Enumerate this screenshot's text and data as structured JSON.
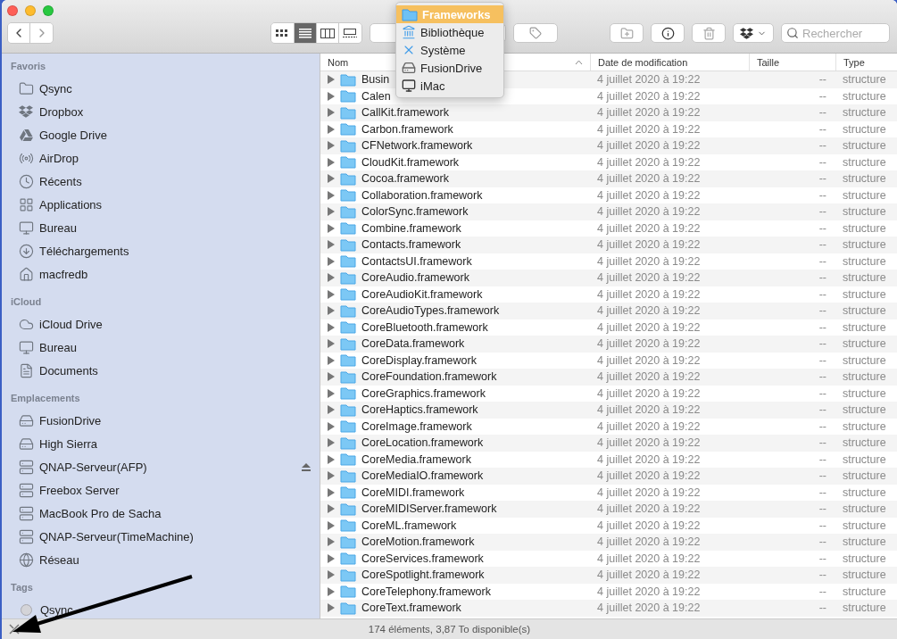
{
  "toolbar": {
    "view_buttons": [
      {
        "kind": "icons",
        "selected": false
      },
      {
        "kind": "list",
        "selected": true
      },
      {
        "kind": "columns",
        "selected": false
      },
      {
        "kind": "gallery",
        "selected": false
      }
    ],
    "search": {
      "placeholder": "Rechercher"
    }
  },
  "path_menu": [
    {
      "label": "Frameworks",
      "kind": "folder",
      "selected": true
    },
    {
      "label": "Bibliothèque",
      "kind": "library",
      "selected": false
    },
    {
      "label": "Système",
      "kind": "system",
      "selected": false
    },
    {
      "label": "FusionDrive",
      "kind": "drive",
      "selected": false
    },
    {
      "label": "iMac",
      "kind": "computer",
      "selected": false
    }
  ],
  "sidebar": [
    {
      "title": "Favoris",
      "items": [
        {
          "label": "Qsync",
          "kind": "folder"
        },
        {
          "label": "Dropbox",
          "kind": "dropbox"
        },
        {
          "label": "Google Drive",
          "kind": "gdrive"
        },
        {
          "label": "AirDrop",
          "kind": "airdrop"
        },
        {
          "label": "Récents",
          "kind": "clock"
        },
        {
          "label": "Applications",
          "kind": "apps"
        },
        {
          "label": "Bureau",
          "kind": "desktop"
        },
        {
          "label": "Téléchargements",
          "kind": "download"
        },
        {
          "label": "macfredb",
          "kind": "home"
        }
      ]
    },
    {
      "title": "iCloud",
      "items": [
        {
          "label": "iCloud Drive",
          "kind": "cloud"
        },
        {
          "label": "Bureau",
          "kind": "desktop"
        },
        {
          "label": "Documents",
          "kind": "document"
        }
      ]
    },
    {
      "title": "Emplacements",
      "items": [
        {
          "label": "FusionDrive",
          "kind": "disk"
        },
        {
          "label": "High Sierra",
          "kind": "disk"
        },
        {
          "label": "QNAP-Serveur(AFP)",
          "kind": "server",
          "ejectable": true
        },
        {
          "label": "Freebox Server",
          "kind": "server"
        },
        {
          "label": "MacBook Pro de Sacha",
          "kind": "server"
        },
        {
          "label": "QNAP-Serveur(TimeMachine)",
          "kind": "server"
        },
        {
          "label": "Réseau",
          "kind": "network"
        }
      ]
    },
    {
      "title": "Tags",
      "items": [
        {
          "label": "Qsync",
          "kind": "tag",
          "color": "#d4d4d8"
        }
      ]
    }
  ],
  "table": {
    "columns": [
      "Nom",
      "Date de modification",
      "Taille",
      "Type"
    ],
    "rows": [
      {
        "name": "Busin",
        "date": "4 juillet 2020 à 19:22",
        "size": "--",
        "type": "structure"
      },
      {
        "name": "Calen",
        "date": "4 juillet 2020 à 19:22",
        "size": "--",
        "type": "structure"
      },
      {
        "name": "CallKit.framework",
        "date": "4 juillet 2020 à 19:22",
        "size": "--",
        "type": "structure"
      },
      {
        "name": "Carbon.framework",
        "date": "4 juillet 2020 à 19:22",
        "size": "--",
        "type": "structure"
      },
      {
        "name": "CFNetwork.framework",
        "date": "4 juillet 2020 à 19:22",
        "size": "--",
        "type": "structure"
      },
      {
        "name": "CloudKit.framework",
        "date": "4 juillet 2020 à 19:22",
        "size": "--",
        "type": "structure"
      },
      {
        "name": "Cocoa.framework",
        "date": "4 juillet 2020 à 19:22",
        "size": "--",
        "type": "structure"
      },
      {
        "name": "Collaboration.framework",
        "date": "4 juillet 2020 à 19:22",
        "size": "--",
        "type": "structure"
      },
      {
        "name": "ColorSync.framework",
        "date": "4 juillet 2020 à 19:22",
        "size": "--",
        "type": "structure"
      },
      {
        "name": "Combine.framework",
        "date": "4 juillet 2020 à 19:22",
        "size": "--",
        "type": "structure"
      },
      {
        "name": "Contacts.framework",
        "date": "4 juillet 2020 à 19:22",
        "size": "--",
        "type": "structure"
      },
      {
        "name": "ContactsUI.framework",
        "date": "4 juillet 2020 à 19:22",
        "size": "--",
        "type": "structure"
      },
      {
        "name": "CoreAudio.framework",
        "date": "4 juillet 2020 à 19:22",
        "size": "--",
        "type": "structure"
      },
      {
        "name": "CoreAudioKit.framework",
        "date": "4 juillet 2020 à 19:22",
        "size": "--",
        "type": "structure"
      },
      {
        "name": "CoreAudioTypes.framework",
        "date": "4 juillet 2020 à 19:22",
        "size": "--",
        "type": "structure"
      },
      {
        "name": "CoreBluetooth.framework",
        "date": "4 juillet 2020 à 19:22",
        "size": "--",
        "type": "structure"
      },
      {
        "name": "CoreData.framework",
        "date": "4 juillet 2020 à 19:22",
        "size": "--",
        "type": "structure"
      },
      {
        "name": "CoreDisplay.framework",
        "date": "4 juillet 2020 à 19:22",
        "size": "--",
        "type": "structure"
      },
      {
        "name": "CoreFoundation.framework",
        "date": "4 juillet 2020 à 19:22",
        "size": "--",
        "type": "structure"
      },
      {
        "name": "CoreGraphics.framework",
        "date": "4 juillet 2020 à 19:22",
        "size": "--",
        "type": "structure"
      },
      {
        "name": "CoreHaptics.framework",
        "date": "4 juillet 2020 à 19:22",
        "size": "--",
        "type": "structure"
      },
      {
        "name": "CoreImage.framework",
        "date": "4 juillet 2020 à 19:22",
        "size": "--",
        "type": "structure"
      },
      {
        "name": "CoreLocation.framework",
        "date": "4 juillet 2020 à 19:22",
        "size": "--",
        "type": "structure"
      },
      {
        "name": "CoreMedia.framework",
        "date": "4 juillet 2020 à 19:22",
        "size": "--",
        "type": "structure"
      },
      {
        "name": "CoreMediaIO.framework",
        "date": "4 juillet 2020 à 19:22",
        "size": "--",
        "type": "structure"
      },
      {
        "name": "CoreMIDI.framework",
        "date": "4 juillet 2020 à 19:22",
        "size": "--",
        "type": "structure"
      },
      {
        "name": "CoreMIDIServer.framework",
        "date": "4 juillet 2020 à 19:22",
        "size": "--",
        "type": "structure"
      },
      {
        "name": "CoreML.framework",
        "date": "4 juillet 2020 à 19:22",
        "size": "--",
        "type": "structure"
      },
      {
        "name": "CoreMotion.framework",
        "date": "4 juillet 2020 à 19:22",
        "size": "--",
        "type": "structure"
      },
      {
        "name": "CoreServices.framework",
        "date": "4 juillet 2020 à 19:22",
        "size": "--",
        "type": "structure"
      },
      {
        "name": "CoreSpotlight.framework",
        "date": "4 juillet 2020 à 19:22",
        "size": "--",
        "type": "structure"
      },
      {
        "name": "CoreTelephony.framework",
        "date": "4 juillet 2020 à 19:22",
        "size": "--",
        "type": "structure"
      },
      {
        "name": "CoreText.framework",
        "date": "4 juillet 2020 à 19:22",
        "size": "--",
        "type": "structure"
      }
    ]
  },
  "status_bar": {
    "text": "174 éléments, 3,87 To disponible(s)"
  }
}
